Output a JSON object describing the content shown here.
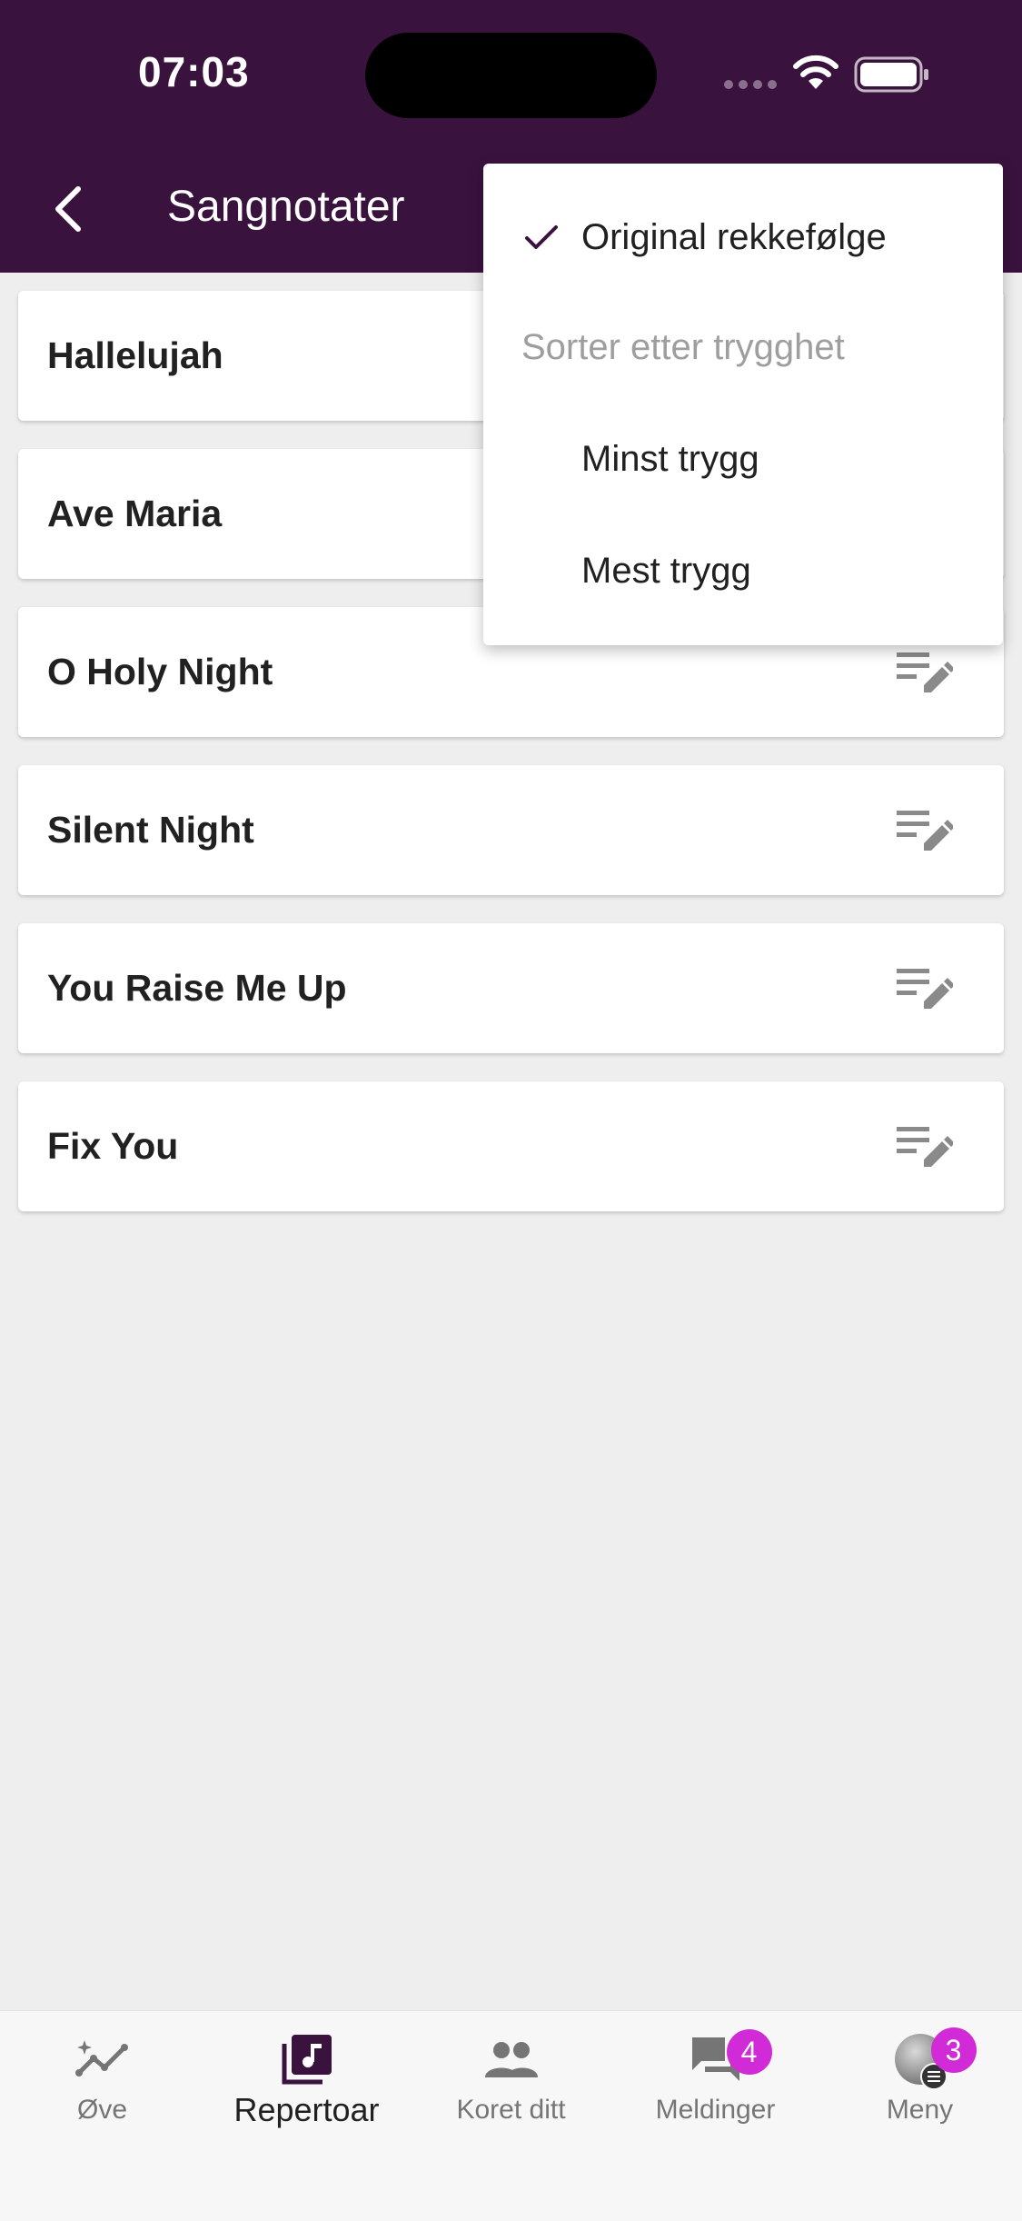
{
  "status_bar": {
    "time": "07:03"
  },
  "header": {
    "title": "Sangnotater"
  },
  "songs": [
    {
      "title": "Hallelujah"
    },
    {
      "title": "Ave Maria"
    },
    {
      "title": "O Holy Night"
    },
    {
      "title": "Silent Night"
    },
    {
      "title": "You Raise Me Up"
    },
    {
      "title": "Fix You"
    }
  ],
  "sort_menu": {
    "selected": "Original rekkefølge",
    "section_header": "Sorter etter trygghet",
    "least": "Minst trygg",
    "most": "Mest trygg"
  },
  "bottom_nav": {
    "items": [
      {
        "label": "Øve"
      },
      {
        "label": "Repertoar"
      },
      {
        "label": "Koret ditt"
      },
      {
        "label": "Meldinger",
        "badge": "4"
      },
      {
        "label": "Meny",
        "badge": "3"
      }
    ]
  },
  "colors": {
    "header_bg": "#3a123e",
    "badge": "#d12bd8",
    "background": "#eeeeee"
  }
}
